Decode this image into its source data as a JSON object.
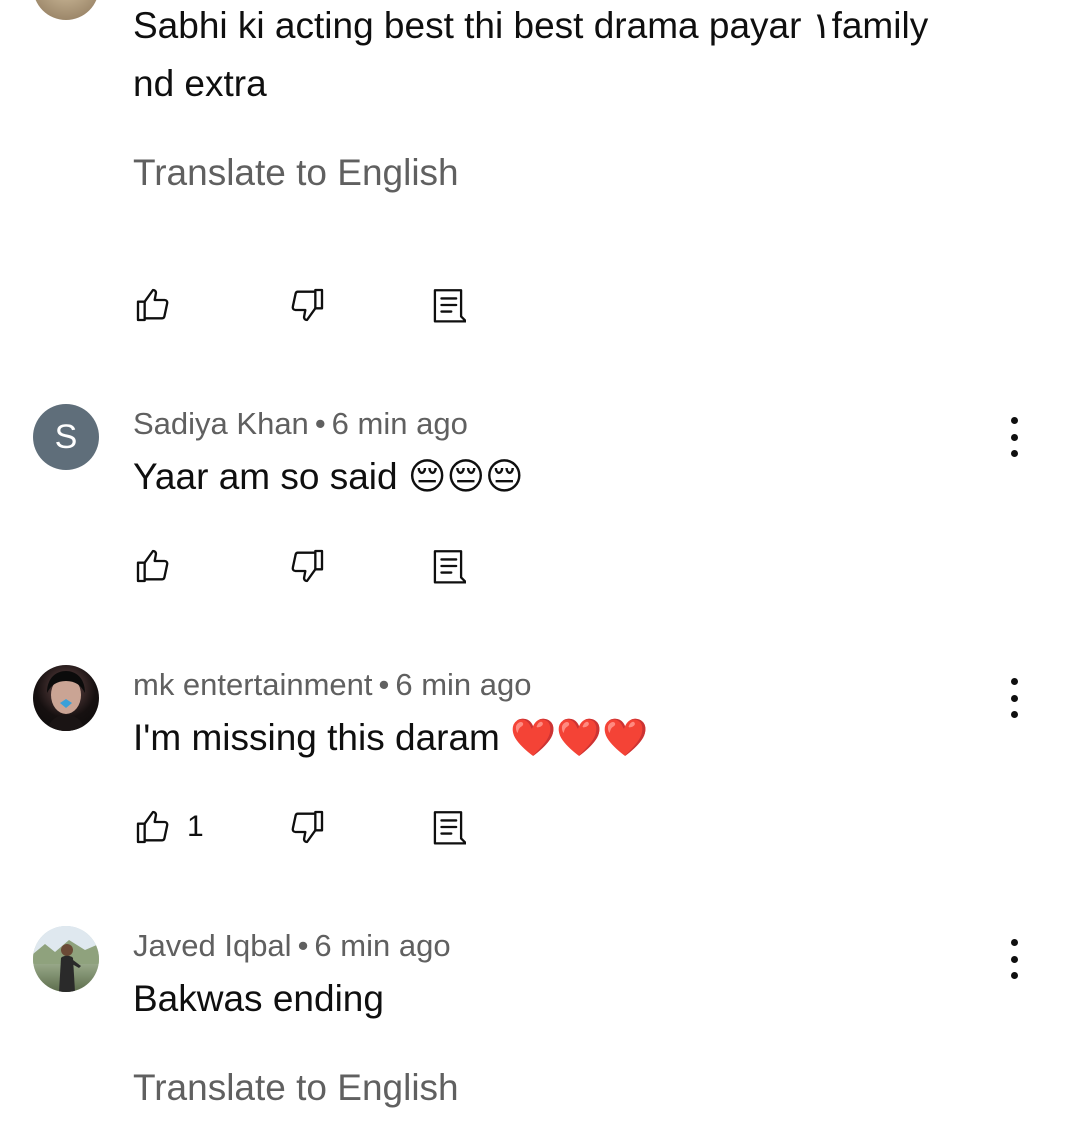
{
  "comments": [
    {
      "author": "",
      "time": "",
      "avatar_icon": "user-photo",
      "text_lines": [
        "Sabhi ki acting best thi best drama payar ۱family",
        "nd extra"
      ],
      "translate_label": "Translate to English",
      "likes": ""
    },
    {
      "author": "Sadiya Khan",
      "time": "6 min ago",
      "separator": "•",
      "avatar_letter": "S",
      "avatar_color": "#5f6e7a",
      "text": "Yaar am so said 😔😔😔",
      "likes": ""
    },
    {
      "author": "mk entertainment",
      "time": "6 min ago",
      "separator": "•",
      "avatar_icon": "user-photo",
      "text": "I'm missing this daram ❤️❤️❤️",
      "likes": "1"
    },
    {
      "author": "Javed Iqbal",
      "time": "6 min ago",
      "separator": "•",
      "avatar_icon": "user-photo",
      "text": "Bakwas ending",
      "translate_label": "Translate to English"
    }
  ],
  "icons": {
    "like": "thumb-up-icon",
    "dislike": "thumb-down-icon",
    "reply": "reply-icon",
    "more": "more-vert-icon"
  }
}
